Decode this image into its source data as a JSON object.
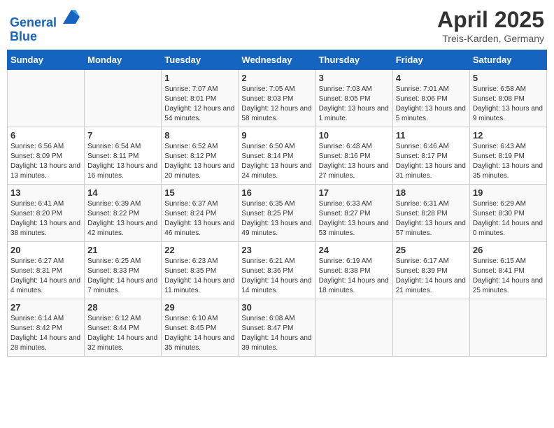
{
  "header": {
    "logo_line1": "General",
    "logo_line2": "Blue",
    "month_title": "April 2025",
    "subtitle": "Treis-Karden, Germany"
  },
  "weekdays": [
    "Sunday",
    "Monday",
    "Tuesday",
    "Wednesday",
    "Thursday",
    "Friday",
    "Saturday"
  ],
  "weeks": [
    [
      {
        "day": "",
        "info": ""
      },
      {
        "day": "",
        "info": ""
      },
      {
        "day": "1",
        "info": "Sunrise: 7:07 AM\nSunset: 8:01 PM\nDaylight: 12 hours and 54 minutes."
      },
      {
        "day": "2",
        "info": "Sunrise: 7:05 AM\nSunset: 8:03 PM\nDaylight: 12 hours and 58 minutes."
      },
      {
        "day": "3",
        "info": "Sunrise: 7:03 AM\nSunset: 8:05 PM\nDaylight: 13 hours and 1 minute."
      },
      {
        "day": "4",
        "info": "Sunrise: 7:01 AM\nSunset: 8:06 PM\nDaylight: 13 hours and 5 minutes."
      },
      {
        "day": "5",
        "info": "Sunrise: 6:58 AM\nSunset: 8:08 PM\nDaylight: 13 hours and 9 minutes."
      }
    ],
    [
      {
        "day": "6",
        "info": "Sunrise: 6:56 AM\nSunset: 8:09 PM\nDaylight: 13 hours and 13 minutes."
      },
      {
        "day": "7",
        "info": "Sunrise: 6:54 AM\nSunset: 8:11 PM\nDaylight: 13 hours and 16 minutes."
      },
      {
        "day": "8",
        "info": "Sunrise: 6:52 AM\nSunset: 8:12 PM\nDaylight: 13 hours and 20 minutes."
      },
      {
        "day": "9",
        "info": "Sunrise: 6:50 AM\nSunset: 8:14 PM\nDaylight: 13 hours and 24 minutes."
      },
      {
        "day": "10",
        "info": "Sunrise: 6:48 AM\nSunset: 8:16 PM\nDaylight: 13 hours and 27 minutes."
      },
      {
        "day": "11",
        "info": "Sunrise: 6:46 AM\nSunset: 8:17 PM\nDaylight: 13 hours and 31 minutes."
      },
      {
        "day": "12",
        "info": "Sunrise: 6:43 AM\nSunset: 8:19 PM\nDaylight: 13 hours and 35 minutes."
      }
    ],
    [
      {
        "day": "13",
        "info": "Sunrise: 6:41 AM\nSunset: 8:20 PM\nDaylight: 13 hours and 38 minutes."
      },
      {
        "day": "14",
        "info": "Sunrise: 6:39 AM\nSunset: 8:22 PM\nDaylight: 13 hours and 42 minutes."
      },
      {
        "day": "15",
        "info": "Sunrise: 6:37 AM\nSunset: 8:24 PM\nDaylight: 13 hours and 46 minutes."
      },
      {
        "day": "16",
        "info": "Sunrise: 6:35 AM\nSunset: 8:25 PM\nDaylight: 13 hours and 49 minutes."
      },
      {
        "day": "17",
        "info": "Sunrise: 6:33 AM\nSunset: 8:27 PM\nDaylight: 13 hours and 53 minutes."
      },
      {
        "day": "18",
        "info": "Sunrise: 6:31 AM\nSunset: 8:28 PM\nDaylight: 13 hours and 57 minutes."
      },
      {
        "day": "19",
        "info": "Sunrise: 6:29 AM\nSunset: 8:30 PM\nDaylight: 14 hours and 0 minutes."
      }
    ],
    [
      {
        "day": "20",
        "info": "Sunrise: 6:27 AM\nSunset: 8:31 PM\nDaylight: 14 hours and 4 minutes."
      },
      {
        "day": "21",
        "info": "Sunrise: 6:25 AM\nSunset: 8:33 PM\nDaylight: 14 hours and 7 minutes."
      },
      {
        "day": "22",
        "info": "Sunrise: 6:23 AM\nSunset: 8:35 PM\nDaylight: 14 hours and 11 minutes."
      },
      {
        "day": "23",
        "info": "Sunrise: 6:21 AM\nSunset: 8:36 PM\nDaylight: 14 hours and 14 minutes."
      },
      {
        "day": "24",
        "info": "Sunrise: 6:19 AM\nSunset: 8:38 PM\nDaylight: 14 hours and 18 minutes."
      },
      {
        "day": "25",
        "info": "Sunrise: 6:17 AM\nSunset: 8:39 PM\nDaylight: 14 hours and 21 minutes."
      },
      {
        "day": "26",
        "info": "Sunrise: 6:15 AM\nSunset: 8:41 PM\nDaylight: 14 hours and 25 minutes."
      }
    ],
    [
      {
        "day": "27",
        "info": "Sunrise: 6:14 AM\nSunset: 8:42 PM\nDaylight: 14 hours and 28 minutes."
      },
      {
        "day": "28",
        "info": "Sunrise: 6:12 AM\nSunset: 8:44 PM\nDaylight: 14 hours and 32 minutes."
      },
      {
        "day": "29",
        "info": "Sunrise: 6:10 AM\nSunset: 8:45 PM\nDaylight: 14 hours and 35 minutes."
      },
      {
        "day": "30",
        "info": "Sunrise: 6:08 AM\nSunset: 8:47 PM\nDaylight: 14 hours and 39 minutes."
      },
      {
        "day": "",
        "info": ""
      },
      {
        "day": "",
        "info": ""
      },
      {
        "day": "",
        "info": ""
      }
    ]
  ]
}
